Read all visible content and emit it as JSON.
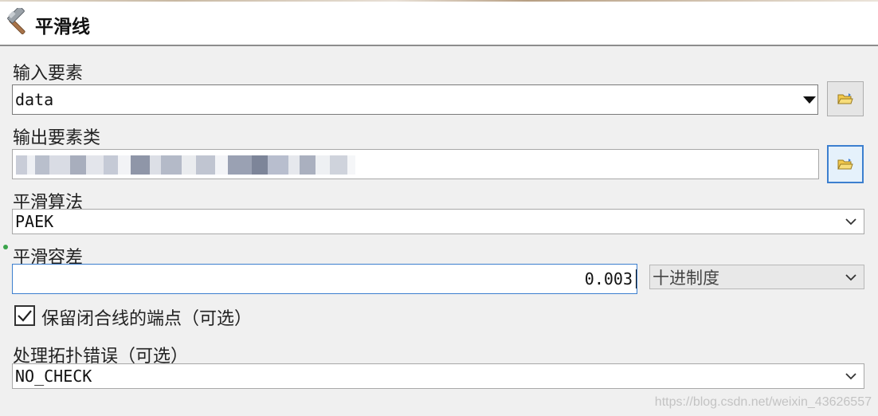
{
  "window": {
    "title": "平滑线",
    "title_icon": "hammer-icon"
  },
  "input_features": {
    "label": "输入要素",
    "value": "data",
    "browse_icon": "folder-open-icon"
  },
  "output_feature_class": {
    "label": "输出要素类",
    "value_redacted": true,
    "browse_icon": "folder-open-icon"
  },
  "smoothing_algorithm": {
    "label": "平滑算法",
    "selected": "PAEK"
  },
  "smoothing_tolerance": {
    "label": "平滑容差",
    "value": "0.003",
    "unit_selected": "十进制度"
  },
  "preserve_endpoints": {
    "label": "保留闭合线的端点（可选）",
    "checked": true
  },
  "handle_topology_errors": {
    "label": "处理拓扑错误（可选）",
    "selected": "NO_CHECK"
  },
  "watermark": "https://blog.csdn.net/weixin_43626557",
  "colors": {
    "focus_border": "#3c7fcf",
    "required_dot": "#3aa34a",
    "background": "#f0f0f0"
  }
}
